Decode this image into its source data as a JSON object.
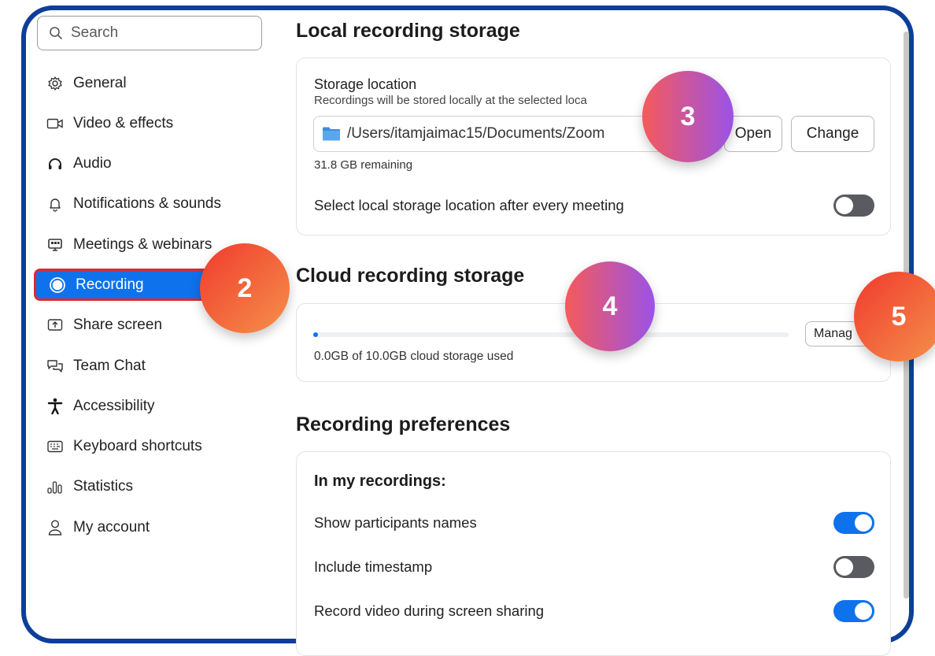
{
  "search": {
    "placeholder": "Search"
  },
  "sidebar": {
    "items": [
      {
        "label": "General",
        "icon": "gear-icon"
      },
      {
        "label": "Video & effects",
        "icon": "video-camera-icon"
      },
      {
        "label": "Audio",
        "icon": "headphones-icon"
      },
      {
        "label": "Notifications & sounds",
        "icon": "bell-icon"
      },
      {
        "label": "Meetings & webinars",
        "icon": "monitor-icon"
      },
      {
        "label": "Recording",
        "icon": "record-icon",
        "active": true
      },
      {
        "label": "Share screen",
        "icon": "share-screen-icon"
      },
      {
        "label": "Team Chat",
        "icon": "chat-bubbles-icon"
      },
      {
        "label": "Accessibility",
        "icon": "accessibility-icon"
      },
      {
        "label": "Keyboard shortcuts",
        "icon": "keyboard-icon"
      },
      {
        "label": "Statistics",
        "icon": "bar-chart-icon"
      },
      {
        "label": "My account",
        "icon": "user-icon"
      }
    ]
  },
  "local": {
    "title": "Local recording storage",
    "storage_label": "Storage location",
    "storage_desc": "Recordings will be stored locally at the selected loca",
    "path": "/Users/itamjaimac15/Documents/Zoom",
    "open_label": "Open",
    "change_label": "Change",
    "remaining": "31.8 GB remaining",
    "select_after_meeting": "Select local storage location after every meeting",
    "select_after_meeting_on": false
  },
  "cloud": {
    "title": "Cloud recording storage",
    "usage": "0.0GB of 10.0GB cloud storage used",
    "used_fraction": 0.0,
    "manage_label": "Manag"
  },
  "prefs": {
    "title": "Recording preferences",
    "subtitle": "In my recordings:",
    "items": [
      {
        "label": "Show participants names",
        "on": true
      },
      {
        "label": "Include timestamp",
        "on": false
      },
      {
        "label": "Record video during screen sharing",
        "on": true
      }
    ]
  },
  "badges": [
    "2",
    "3",
    "4",
    "5"
  ],
  "colors": {
    "accent": "#0e72ed",
    "frame": "#0d3e99",
    "active_border": "#e0292b",
    "toggle_off": "#5a5b60"
  }
}
